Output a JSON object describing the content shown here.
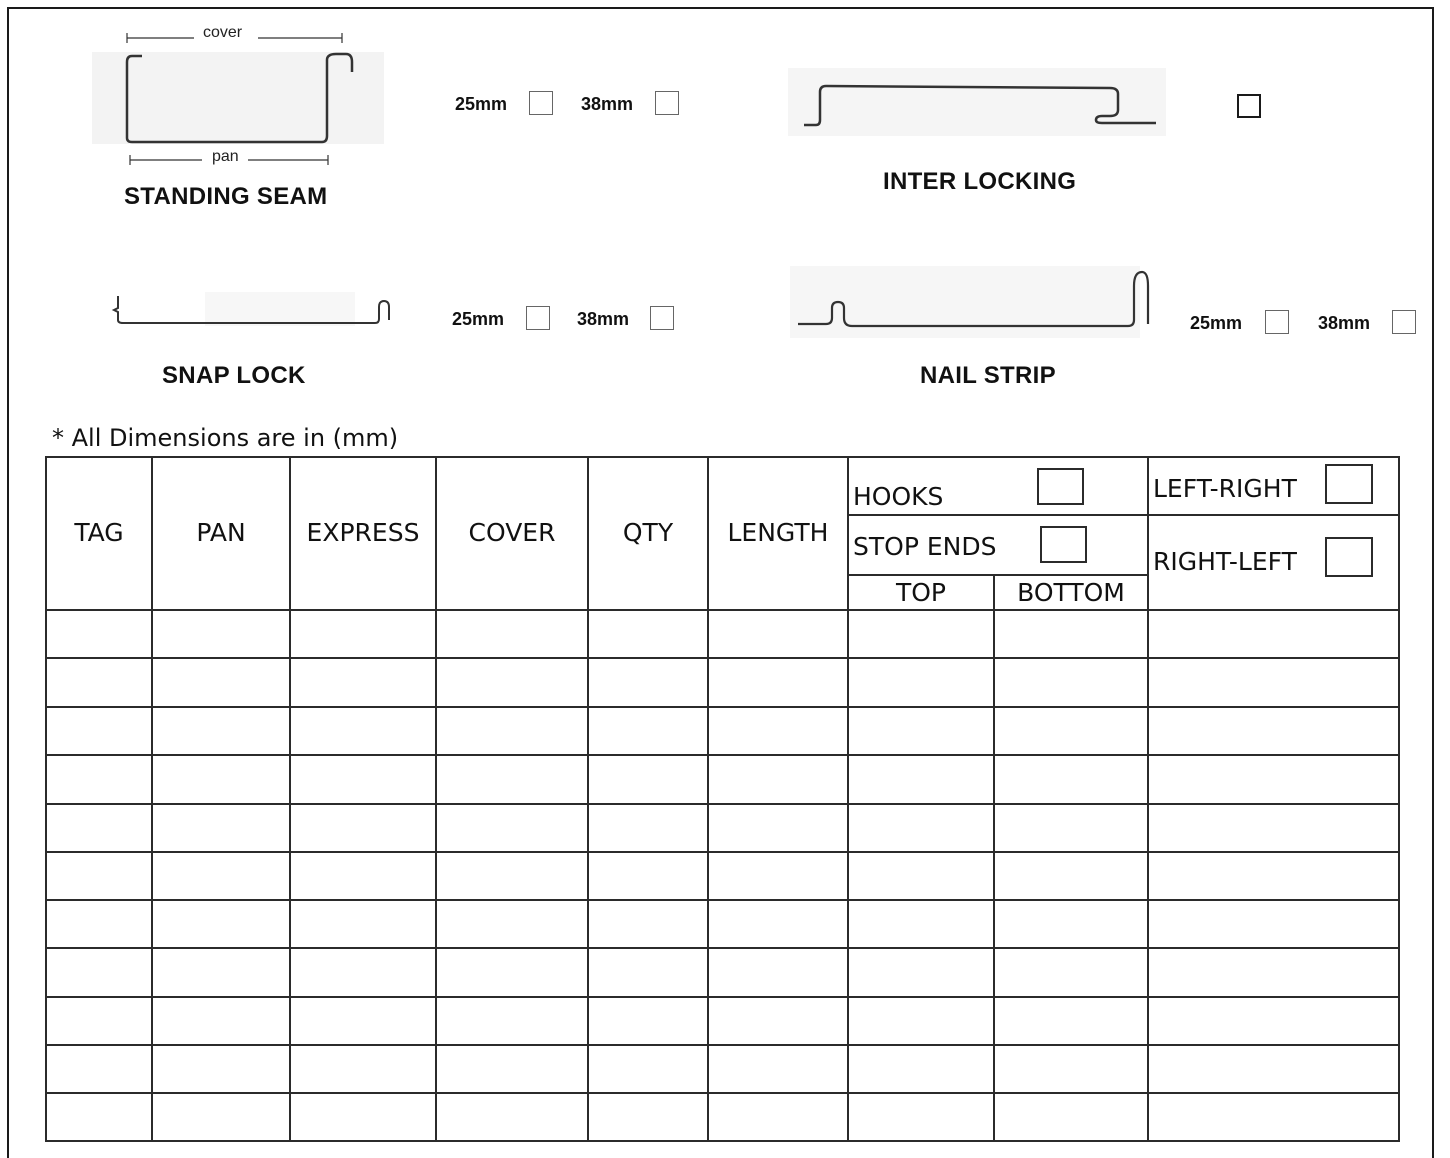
{
  "profiles": {
    "standing_seam": {
      "label": "STANDING SEAM",
      "dim_cover": "cover",
      "dim_pan": "pan",
      "option_25": "25mm",
      "option_38": "38mm"
    },
    "inter_locking": {
      "label": "INTER LOCKING"
    },
    "snap_lock": {
      "label": "SNAP LOCK",
      "option_25": "25mm",
      "option_38": "38mm"
    },
    "nail_strip": {
      "label": "NAIL STRIP",
      "option_25": "25mm",
      "option_38": "38mm"
    }
  },
  "note": "* All Dimensions are in (mm)",
  "table": {
    "headers": {
      "tag": "TAG",
      "pan": "PAN",
      "express": "EXPRESS",
      "cover": "COVER",
      "qty": "QTY",
      "length": "LENGTH",
      "hooks": "HOOKS",
      "stop_ends": "STOP ENDS",
      "top": "TOP",
      "bottom": "BOTTOM",
      "left_right": "LEFT-RIGHT",
      "right_left": "RIGHT-LEFT"
    },
    "row_count": 11
  }
}
